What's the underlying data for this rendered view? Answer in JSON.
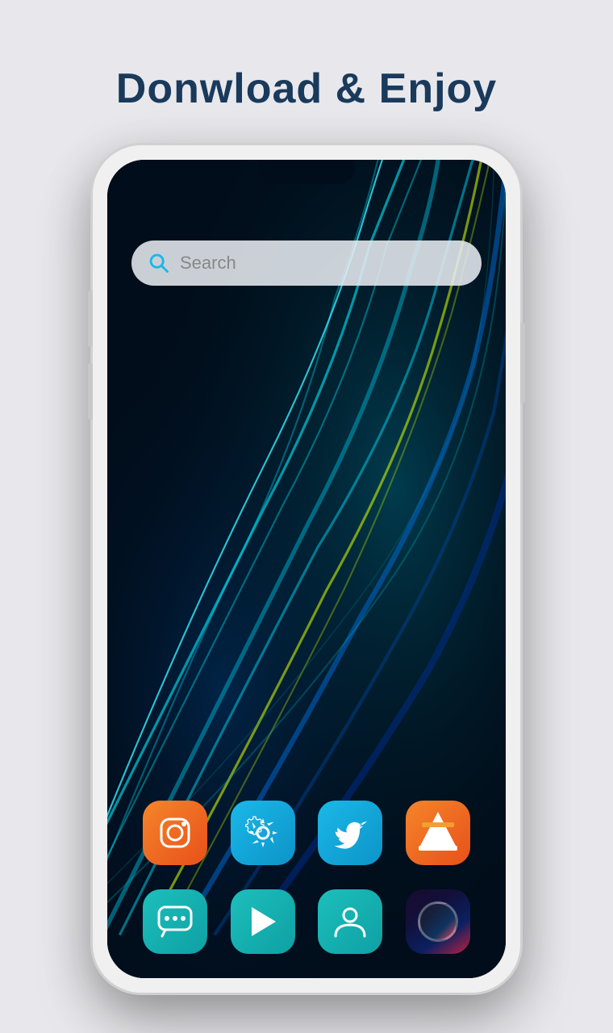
{
  "page": {
    "title": "Donwload & Enjoy",
    "background_color": "#e8e8ec"
  },
  "search": {
    "placeholder": "Search"
  },
  "dock_main": [
    {
      "id": "instagram",
      "label": "Instagram",
      "color": "orange",
      "icon": "instagram-icon"
    },
    {
      "id": "settings",
      "label": "Settings",
      "color": "cyan",
      "icon": "settings-icon"
    },
    {
      "id": "twitter",
      "label": "Twitter",
      "color": "cyan",
      "icon": "twitter-icon"
    },
    {
      "id": "vlc",
      "label": "VLC",
      "color": "orange",
      "icon": "vlc-icon"
    }
  ],
  "dock_bottom": [
    {
      "id": "messages",
      "label": "Messages",
      "color": "teal",
      "icon": "messages-icon"
    },
    {
      "id": "playstore",
      "label": "Play Store",
      "color": "teal",
      "icon": "playstore-icon"
    },
    {
      "id": "contacts",
      "label": "Contacts",
      "color": "teal",
      "icon": "contacts-icon"
    },
    {
      "id": "camera",
      "label": "Camera",
      "color": "dark",
      "icon": "camera-icon"
    }
  ]
}
